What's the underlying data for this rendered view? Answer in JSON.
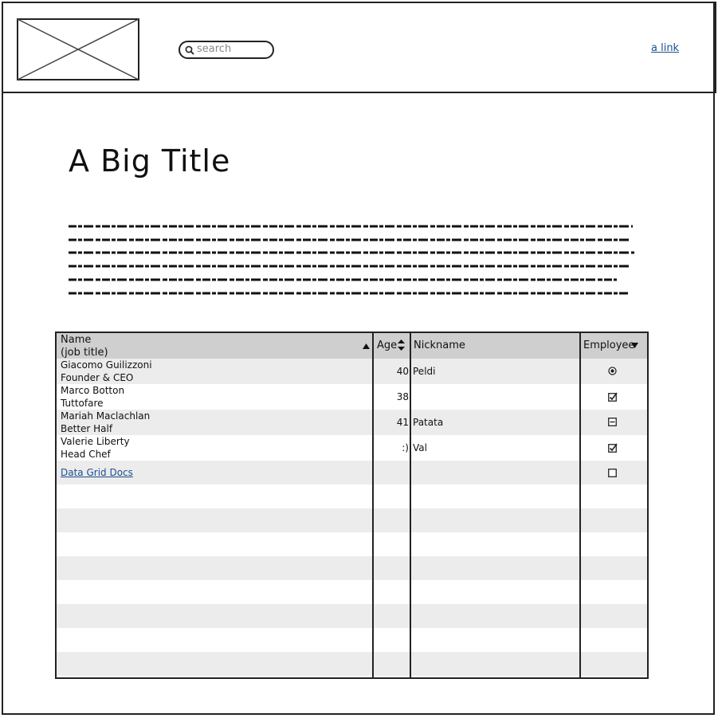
{
  "header": {
    "search_placeholder": "search",
    "link_label": "a link"
  },
  "main": {
    "title": "A Big Title"
  },
  "table": {
    "columns": {
      "name": "Name",
      "name_sub": "(job title)",
      "age": "Age",
      "nickname": "Nickname",
      "employee": "Employee"
    },
    "rows": [
      {
        "name": "Giacomo Guilizzoni",
        "title": "Founder & CEO",
        "age": "40",
        "nickname": "Peldi",
        "employee": "radio-selected"
      },
      {
        "name": "Marco Botton",
        "title": "Tuttofare",
        "age": "38",
        "nickname": "",
        "employee": "checked"
      },
      {
        "name": "Mariah Maclachlan",
        "title": "Better Half",
        "age": "41",
        "nickname": "Patata",
        "employee": "indeterminate"
      },
      {
        "name": "Valerie Liberty",
        "title": "Head Chef",
        "age": ":)",
        "nickname": "Val",
        "employee": "checked"
      }
    ],
    "footer_link": "Data Grid Docs",
    "footer_employee": "unchecked"
  }
}
